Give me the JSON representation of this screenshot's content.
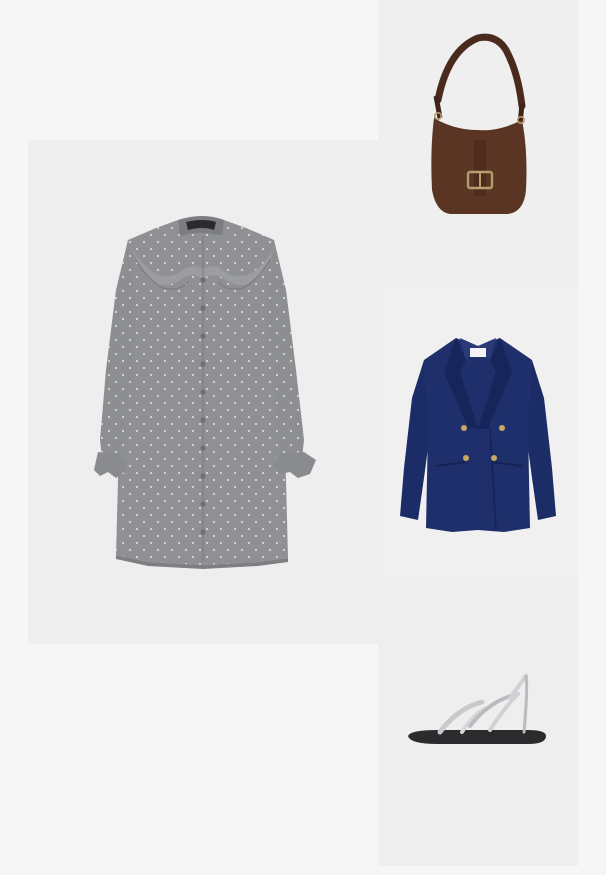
{
  "colors": {
    "page_background": "#f6f6f6",
    "dress": "#8f9094",
    "bag": "#5a3524",
    "blazer": "#1e2f6b",
    "sandal_strap": "#c7c9cc",
    "sandal_sole": "#2b2b2d"
  },
  "products": [
    {
      "name": "grey-polka-dot-ruffle-shirt-dress",
      "image": "dress-image"
    },
    {
      "name": "brown-suede-buckle-shoulder-bag",
      "image": "bag-image"
    },
    {
      "name": "navy-double-breasted-blazer",
      "image": "blazer-image"
    },
    {
      "name": "silver-strappy-flat-sandal",
      "image": "sandal-image"
    }
  ]
}
